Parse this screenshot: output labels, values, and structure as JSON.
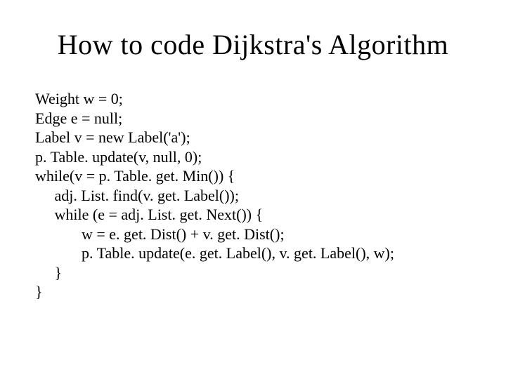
{
  "title": "How to code Dijkstra's Algorithm",
  "code": "Weight w = 0;\nEdge e = null;\nLabel v = new Label('a');\np. Table. update(v, null, 0);\nwhile(v = p. Table. get. Min()) {\n     adj. List. find(v. get. Label());\n     while (e = adj. List. get. Next()) {\n            w = e. get. Dist() + v. get. Dist();\n            p. Table. update(e. get. Label(), v. get. Label(), w);\n     }\n}"
}
